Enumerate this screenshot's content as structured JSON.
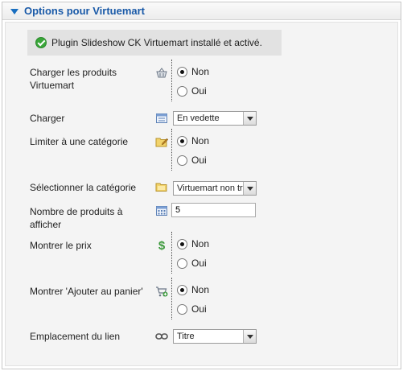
{
  "panel": {
    "title": "Options pour Virtuemart",
    "message": "Plugin Slideshow CK Virtuemart installé et activé."
  },
  "fields": {
    "load_products": {
      "label": "Charger les produits Virtuemart",
      "options": [
        "Non",
        "Oui"
      ],
      "selected": "Non",
      "icon": "basket-icon"
    },
    "load": {
      "label": "Charger",
      "value": "En vedette",
      "icon": "list-icon"
    },
    "limit_category": {
      "label": "Limiter à une catégorie",
      "options": [
        "Non",
        "Oui"
      ],
      "selected": "Non",
      "icon": "folder-edit-icon"
    },
    "select_category": {
      "label": "Sélectionner la catégorie",
      "value": "Virtuemart non tro",
      "icon": "folder-icon"
    },
    "num_products": {
      "label": "Nombre de produits à afficher",
      "value": "5",
      "icon": "calendar-grid-icon"
    },
    "show_price": {
      "label": "Montrer le prix",
      "options": [
        "Non",
        "Oui"
      ],
      "selected": "Non",
      "icon": "dollar-icon"
    },
    "show_add_cart": {
      "label": "Montrer 'Ajouter au panier'",
      "options": [
        "Non",
        "Oui"
      ],
      "selected": "Non",
      "icon": "cart-add-icon"
    },
    "link_location": {
      "label": "Emplacement du lien",
      "value": "Titre",
      "icon": "link-icon"
    }
  }
}
